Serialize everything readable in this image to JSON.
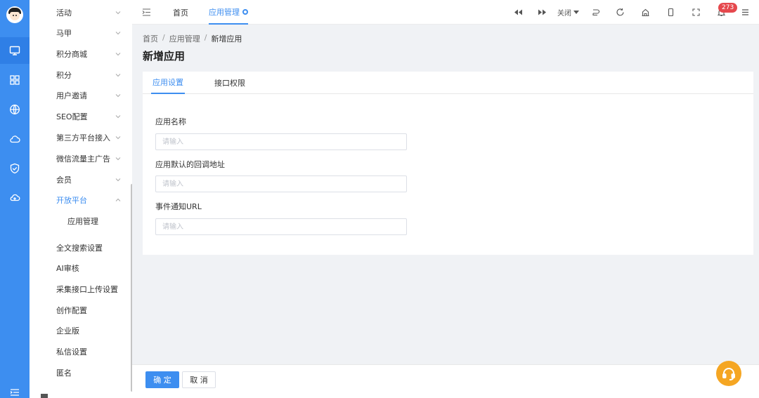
{
  "sidebar": {
    "menu": [
      {
        "label": "活动"
      },
      {
        "label": "马甲"
      },
      {
        "label": "积分商城"
      },
      {
        "label": "积分"
      },
      {
        "label": "用户邀请"
      },
      {
        "label": "SEO配置"
      },
      {
        "label": "第三方平台接入"
      },
      {
        "label": "微信流量主广告"
      },
      {
        "label": "会员"
      },
      {
        "label": "开放平台",
        "state": "expanded"
      },
      {
        "label": "应用管理",
        "child": true
      },
      {
        "label": "全文搜索设置"
      },
      {
        "label": "AI审核"
      },
      {
        "label": "采集接口上传设置"
      },
      {
        "label": "创作配置"
      },
      {
        "label": "企业版"
      },
      {
        "label": "私信设置"
      },
      {
        "label": "匿名"
      }
    ]
  },
  "rail": {
    "icons": [
      "monitor-icon",
      "grid-icon",
      "globe-icon",
      "cloud-icon",
      "shield-check-icon",
      "cloud-sync-icon"
    ],
    "accent": "#3d8ef0"
  },
  "topbar": {
    "tabs": [
      {
        "label": "首页"
      },
      {
        "label": "应用管理",
        "active": true
      }
    ],
    "close_label": "关闭",
    "notification_count": "273"
  },
  "breadcrumb": {
    "home": "首页",
    "section": "应用管理",
    "current": "新增应用",
    "separator": "/"
  },
  "page": {
    "title": "新增应用"
  },
  "form": {
    "tabs": [
      {
        "label": "应用设置",
        "active": true
      },
      {
        "label": "接口权限"
      }
    ],
    "fields": [
      {
        "label": "应用名称",
        "placeholder": "请输入",
        "value": ""
      },
      {
        "label": "应用默认的回调地址",
        "placeholder": "请输入",
        "value": ""
      },
      {
        "label": "事件通知URL",
        "placeholder": "请输入",
        "value": ""
      }
    ]
  },
  "footer": {
    "confirm_label": "确 定",
    "cancel_label": "取 消"
  },
  "colors": {
    "primary": "#3d8ef0",
    "badge": "#e5484d",
    "support": "#f5a623"
  }
}
